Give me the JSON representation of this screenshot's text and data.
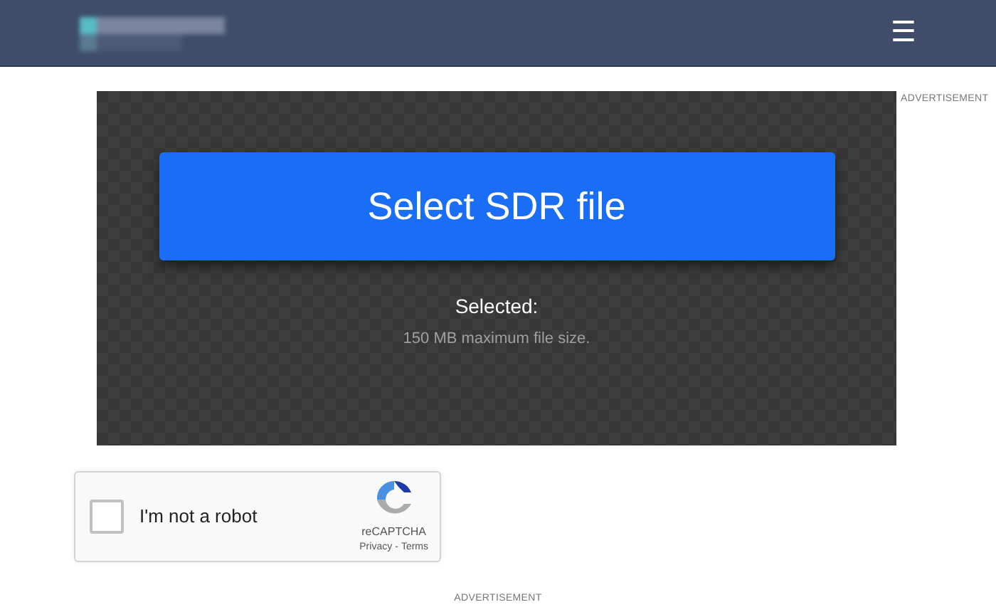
{
  "header": {
    "menu_icon": "☰"
  },
  "upload": {
    "button": "Select SDR file",
    "selected_label": "Selected:",
    "limit": "150 MB maximum file size."
  },
  "ads": [
    "ADVERTISEMENT",
    "ADVERTISEMENT"
  ],
  "captcha": {
    "label": "I'm not a robot",
    "checked": false,
    "brand": "reCAPTCHA",
    "privacy": "Privacy",
    "separator": "-",
    "terms": "Terms"
  }
}
